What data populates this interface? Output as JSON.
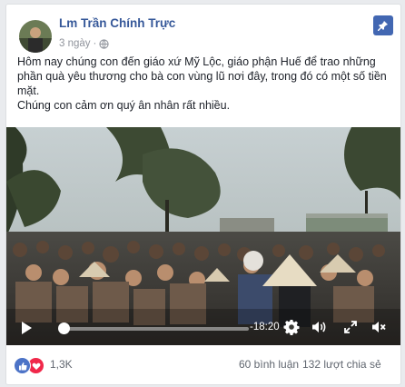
{
  "post": {
    "author": "Lm Trần Chính Trực",
    "time": "3 ngày",
    "body_lines": [
      "Hôm nay chúng con đến giáo xứ Mỹ Lộc, giáo phận Huế để trao những phần quà yêu thương cho bà con vùng lũ nơi đây, trong đó có một số tiền mặt.",
      "Chúng con cảm ơn quý ân nhân rất nhiều."
    ]
  },
  "video": {
    "time_remaining": "-18:20",
    "progress": 0.02
  },
  "stats": {
    "reaction_count": "1,3K",
    "comments": "60 bình luận",
    "shares": "132 lượt chia sẻ"
  },
  "icons": [
    "globe-icon",
    "pin-icon",
    "play-icon",
    "gear-icon",
    "volume-icon",
    "expand-icon",
    "mute-icon",
    "like-icon",
    "love-icon"
  ],
  "colors": {
    "link": "#365899",
    "accent": "#4267b2",
    "like": "#4c73c7",
    "love": "#f0284a"
  }
}
